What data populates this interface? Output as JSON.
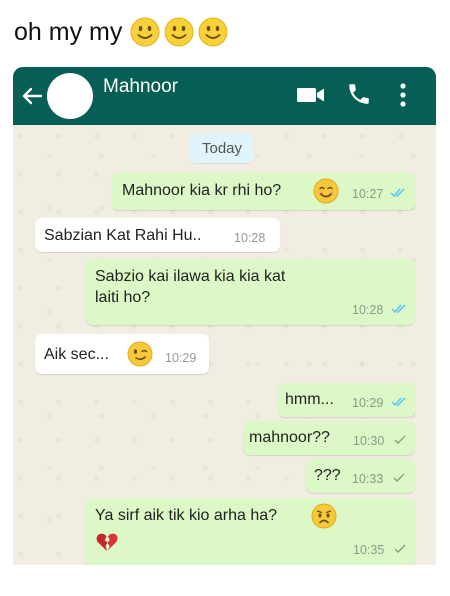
{
  "caption": {
    "text": "oh my my",
    "emojis": [
      "slightly-smiling-face",
      "slightly-smiling-face",
      "slightly-smiling-face"
    ]
  },
  "header": {
    "contact_name": "Mahnoor",
    "color": "#075e54"
  },
  "chat": {
    "date_label": "Today",
    "messages": [
      {
        "direction": "outgoing",
        "text": "Mahnoor kia kr rhi ho?",
        "emoji": "smiling-face",
        "time": "10:27",
        "status": "read"
      },
      {
        "direction": "incoming",
        "text": "Sabzian Kat Rahi Hu..",
        "time": "10:28"
      },
      {
        "direction": "outgoing",
        "text_line1": "Sabzio kai ilawa kia kia kat",
        "text_line2": "laiti ho?",
        "time": "10:28",
        "status": "read"
      },
      {
        "direction": "incoming",
        "text": "Aik sec...",
        "emoji": "winking-face",
        "time": "10:29"
      },
      {
        "direction": "outgoing",
        "text": "hmm...",
        "time": "10:29",
        "status": "read"
      },
      {
        "direction": "outgoing",
        "text": "mahnoor??",
        "time": "10:30",
        "status": "sent"
      },
      {
        "direction": "outgoing",
        "text": "???",
        "time": "10:33",
        "status": "sent"
      },
      {
        "direction": "outgoing",
        "text": "Ya sirf aik tik kio arha ha?",
        "emoji": "worried-face",
        "emoji2": "broken-heart",
        "time": "10:35",
        "status": "sent"
      }
    ]
  },
  "colors": {
    "outgoing_bubble": "#dcf8c6",
    "incoming_bubble": "#ffffff",
    "read_tick": "#4fc3f7",
    "sent_tick": "#8a9a8a"
  }
}
